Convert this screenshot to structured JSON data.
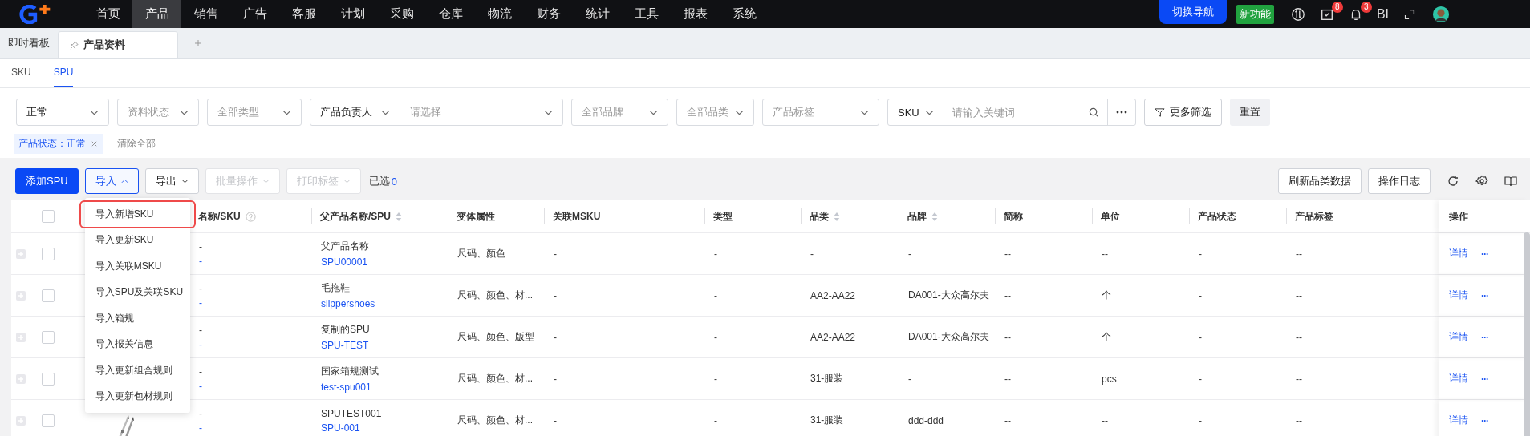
{
  "nav": {
    "items": [
      {
        "label": "首页",
        "selected": false
      },
      {
        "label": "产品",
        "selected": true
      },
      {
        "label": "销售",
        "selected": false
      },
      {
        "label": "广告",
        "selected": false
      },
      {
        "label": "客服",
        "selected": false
      },
      {
        "label": "计划",
        "selected": false
      },
      {
        "label": "采购",
        "selected": false
      },
      {
        "label": "仓库",
        "selected": false
      },
      {
        "label": "物流",
        "selected": false
      },
      {
        "label": "财务",
        "selected": false
      },
      {
        "label": "统计",
        "selected": false
      },
      {
        "label": "工具",
        "selected": false
      },
      {
        "label": "报表",
        "selected": false
      },
      {
        "label": "系统",
        "selected": false
      }
    ],
    "switch_button": "切换导航",
    "new_badge": "新功能",
    "task_count": "8",
    "notice_count": "3",
    "bi": "BI"
  },
  "page_tabs": [
    {
      "label": "即时看板",
      "selected": false
    },
    {
      "label": "产品资料",
      "selected": true
    }
  ],
  "sub_tabs": [
    {
      "label": "SKU",
      "selected": false
    },
    {
      "label": "SPU",
      "selected": true
    }
  ],
  "filters": [
    {
      "kind": "select",
      "value": "正常"
    },
    {
      "kind": "select",
      "placeholder": "资料状态"
    },
    {
      "kind": "select",
      "placeholder": "全部类型"
    },
    {
      "kind": "combo",
      "value": "产品负责人",
      "placeholder": "请选择"
    },
    {
      "kind": "select",
      "placeholder": "全部品牌"
    },
    {
      "kind": "select",
      "placeholder": "全部品类"
    },
    {
      "kind": "select",
      "placeholder": "产品标签"
    },
    {
      "kind": "search",
      "value": "SKU",
      "placeholder": "请输入关键词"
    }
  ],
  "more_filters": "更多筛选",
  "reset": "重置",
  "chips": [
    {
      "label": "产品状态：正常"
    }
  ],
  "clear_all": "清除全部",
  "toolbar": {
    "add": "添加SPU",
    "import": {
      "label": "导入",
      "expanded": true
    },
    "export": {
      "label": "导出",
      "expanded": false
    },
    "batch": {
      "label": "批量操作",
      "disabled": true
    },
    "print": {
      "label": "打印标签",
      "disabled": true
    },
    "selected_label": "已选",
    "selected_count": "0",
    "refresh": "刷新品类数据",
    "log": "操作日志"
  },
  "import_menu": [
    {
      "label": "导入新增SKU",
      "highlighted": true
    },
    {
      "label": "导入更新SKU",
      "highlighted": false
    },
    {
      "label": "导入关联MSKU",
      "highlighted": false
    },
    {
      "label": "导入SPU及关联SKU",
      "highlighted": false
    },
    {
      "label": "导入箱规",
      "highlighted": false
    },
    {
      "label": "导入报关信息",
      "highlighted": false
    },
    {
      "label": "导入更新组合规则",
      "highlighted": false
    },
    {
      "label": "导入更新包材规则",
      "highlighted": false
    }
  ],
  "table": {
    "columns": [
      {
        "label": "名称/SKU",
        "sortable": false,
        "help": true
      },
      {
        "label": "父产品名称/SPU",
        "sortable": true,
        "help": false
      },
      {
        "label": "变体属性",
        "sortable": false,
        "help": false
      },
      {
        "label": "关联MSKU",
        "sortable": false,
        "help": false
      },
      {
        "label": "类型",
        "sortable": false,
        "help": false
      },
      {
        "label": "品类",
        "sortable": true,
        "help": false
      },
      {
        "label": "品牌",
        "sortable": true,
        "help": false
      },
      {
        "label": "简称",
        "sortable": false,
        "help": false
      },
      {
        "label": "单位",
        "sortable": false,
        "help": false
      },
      {
        "label": "产品状态",
        "sortable": false,
        "help": false
      },
      {
        "label": "产品标签",
        "sortable": false,
        "help": false
      }
    ],
    "actions_header": "操作",
    "all_checked": false,
    "rows": [
      {
        "checked": false,
        "image": null,
        "name": "-",
        "sku": "-",
        "parent_name": "父产品名称",
        "spu": "SPU00001",
        "variant": "尺码、颜色",
        "msku": "-",
        "type": "-",
        "category": "-",
        "brand": "-",
        "abbr": "--",
        "unit": "--",
        "status": "-",
        "tags": "--",
        "detail": "详情",
        "more": "···"
      },
      {
        "checked": false,
        "image": null,
        "name": "-",
        "sku": "-",
        "parent_name": "毛拖鞋",
        "spu": "slippershoes",
        "variant": "尺码、颜色、材...",
        "msku": "-",
        "type": "-",
        "category": "AA2-AA22",
        "brand": "DA001-大众高尔夫",
        "abbr": "--",
        "unit": "个",
        "status": "-",
        "tags": "--",
        "detail": "详情",
        "more": "···"
      },
      {
        "checked": false,
        "image": null,
        "name": "-",
        "sku": "-",
        "parent_name": "复制的SPU",
        "spu": "SPU-TEST",
        "variant": "尺码、颜色、版型",
        "msku": "-",
        "type": "-",
        "category": "AA2-AA22",
        "brand": "DA001-大众高尔夫",
        "abbr": "--",
        "unit": "个",
        "status": "-",
        "tags": "--",
        "detail": "详情",
        "more": "···"
      },
      {
        "checked": false,
        "image": null,
        "name": "-",
        "sku": "-",
        "parent_name": "国家箱规测试",
        "spu": "test-spu001",
        "variant": "尺码、颜色、材...",
        "msku": "-",
        "type": "-",
        "category": "31-服装",
        "brand": "-",
        "abbr": "--",
        "unit": "pcs",
        "status": "-",
        "tags": "--",
        "detail": "详情",
        "more": "···"
      },
      {
        "checked": false,
        "name": "-",
        "sku": "-",
        "parent_name": "SPUTEST001",
        "spu": "SPU-001",
        "variant": "尺码、颜色、材...",
        "msku": "-",
        "type": "-",
        "category": "31-服装",
        "brand": "ddd-ddd",
        "abbr": "--",
        "unit": "--",
        "status": "-",
        "tags": "--",
        "detail": "详情",
        "more": "···"
      }
    ]
  }
}
